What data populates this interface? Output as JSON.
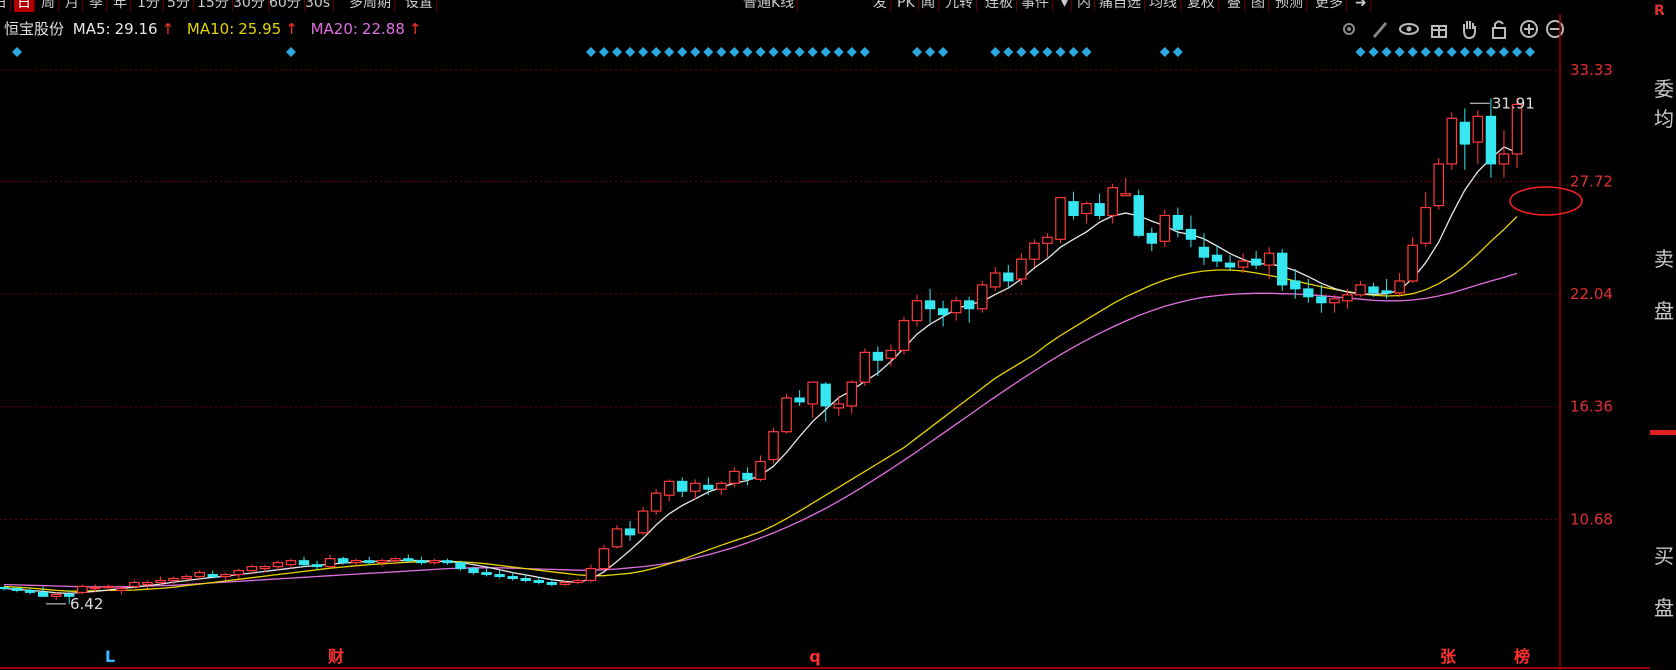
{
  "toolbar": {
    "items": [
      "日",
      "日",
      "周",
      "月",
      "季",
      "年",
      "1分",
      "5分",
      "15分",
      "30分",
      "60分",
      "30s",
      "多周期",
      "设置",
      "普通K线",
      "发",
      "PK",
      "闻",
      "九转",
      "连板",
      "事件",
      "▾",
      "内",
      "痛自选",
      "均线",
      "复权",
      "叠",
      "图",
      "预测",
      "更多",
      "➜"
    ],
    "active": "日"
  },
  "legend": {
    "stock_name": "恒宝股份",
    "ma5_label": "MA5:",
    "ma5_value": "29.16",
    "ma10_label": "MA10:",
    "ma10_value": "25.95",
    "ma20_label": "MA20:",
    "ma20_value": "22.88",
    "arrow": "↑"
  },
  "tools": [
    "settings-icon",
    "draw-icon",
    "eye-icon",
    "gift-icon",
    "hand-icon",
    "lock-icon",
    "zoom-in-icon",
    "zoom-out-icon"
  ],
  "colors": {
    "up": "#ff3b3b",
    "down": "#36e6f0",
    "ma5": "#e8e8e8",
    "ma10": "#e6d400",
    "ma20": "#e070e0",
    "grid": "#7a0000",
    "axis_text": "#e03030",
    "diamond": "#2aa8e0",
    "marker_blue": "#3ab8ff",
    "marker_red": "#ff3030"
  },
  "side_labels": [
    "R",
    "委",
    "均",
    "卖",
    "盘",
    "买",
    "盘"
  ],
  "chart_data": {
    "type": "candlestick",
    "ylim": [
      4.6,
      35.2
    ],
    "yticks": [
      10.68,
      16.36,
      22.04,
      27.72,
      33.33
    ],
    "y_tick_labels": [
      "10.68",
      "16.36",
      "22.04",
      "27.72",
      "33.33"
    ],
    "high_label": "31.91",
    "low_label": "6.42",
    "candles": [
      [
        7.25,
        7.3,
        7.1,
        7.2
      ],
      [
        7.2,
        7.25,
        7.0,
        7.1
      ],
      [
        7.1,
        7.2,
        6.9,
        7.0
      ],
      [
        7.0,
        7.3,
        6.9,
        6.8
      ],
      [
        6.8,
        7.0,
        6.6,
        6.9
      ],
      [
        6.9,
        7.1,
        6.42,
        6.8
      ],
      [
        7.0,
        7.4,
        6.9,
        7.3
      ],
      [
        7.2,
        7.4,
        7.0,
        7.25
      ],
      [
        7.25,
        7.4,
        7.1,
        7.3
      ],
      [
        7.1,
        7.3,
        6.9,
        7.2
      ],
      [
        7.3,
        7.6,
        7.2,
        7.5
      ],
      [
        7.4,
        7.6,
        7.2,
        7.5
      ],
      [
        7.5,
        7.8,
        7.4,
        7.6
      ],
      [
        7.6,
        7.8,
        7.4,
        7.7
      ],
      [
        7.7,
        7.9,
        7.5,
        7.8
      ],
      [
        7.8,
        8.1,
        7.6,
        8.0
      ],
      [
        7.9,
        8.1,
        7.7,
        7.8
      ],
      [
        7.8,
        8.0,
        7.6,
        7.9
      ],
      [
        7.9,
        8.2,
        7.7,
        8.1
      ],
      [
        8.1,
        8.4,
        7.9,
        8.3
      ],
      [
        8.2,
        8.4,
        8.0,
        8.3
      ],
      [
        8.3,
        8.6,
        8.1,
        8.5
      ],
      [
        8.4,
        8.7,
        8.2,
        8.6
      ],
      [
        8.6,
        8.8,
        8.3,
        8.4
      ],
      [
        8.4,
        8.6,
        8.1,
        8.3
      ],
      [
        8.3,
        8.9,
        8.2,
        8.7
      ],
      [
        8.7,
        8.8,
        8.4,
        8.5
      ],
      [
        8.5,
        8.7,
        8.3,
        8.6
      ],
      [
        8.6,
        8.8,
        8.4,
        8.5
      ],
      [
        8.5,
        8.7,
        8.3,
        8.6
      ],
      [
        8.6,
        8.8,
        8.4,
        8.7
      ],
      [
        8.7,
        8.9,
        8.5,
        8.6
      ],
      [
        8.6,
        8.8,
        8.4,
        8.5
      ],
      [
        8.5,
        8.7,
        8.4,
        8.6
      ],
      [
        8.6,
        8.7,
        8.4,
        8.5
      ],
      [
        8.5,
        8.6,
        8.1,
        8.2
      ],
      [
        8.2,
        8.3,
        7.9,
        8.0
      ],
      [
        8.0,
        8.2,
        7.8,
        7.9
      ],
      [
        7.9,
        8.1,
        7.7,
        7.8
      ],
      [
        7.8,
        8.0,
        7.6,
        7.7
      ],
      [
        7.7,
        7.9,
        7.5,
        7.6
      ],
      [
        7.6,
        7.8,
        7.4,
        7.5
      ],
      [
        7.5,
        7.7,
        7.3,
        7.4
      ],
      [
        7.4,
        7.6,
        7.3,
        7.5
      ],
      [
        7.5,
        7.7,
        7.4,
        7.6
      ],
      [
        7.6,
        8.4,
        7.5,
        8.2
      ],
      [
        8.2,
        9.4,
        8.1,
        9.2
      ],
      [
        9.3,
        10.4,
        9.2,
        10.2
      ],
      [
        10.2,
        10.6,
        9.6,
        9.9
      ],
      [
        10.0,
        11.3,
        9.9,
        11.1
      ],
      [
        11.1,
        12.2,
        10.9,
        12.0
      ],
      [
        11.9,
        12.7,
        11.6,
        12.6
      ],
      [
        12.6,
        12.8,
        11.8,
        12.1
      ],
      [
        12.1,
        12.7,
        11.7,
        12.5
      ],
      [
        12.4,
        12.8,
        11.9,
        12.2
      ],
      [
        12.2,
        12.6,
        11.9,
        12.5
      ],
      [
        12.5,
        13.3,
        12.3,
        13.1
      ],
      [
        13.0,
        13.3,
        12.4,
        12.7
      ],
      [
        12.7,
        13.9,
        12.6,
        13.6
      ],
      [
        13.7,
        15.3,
        13.5,
        15.1
      ],
      [
        15.1,
        17.0,
        15.0,
        16.8
      ],
      [
        16.8,
        17.2,
        16.4,
        16.6
      ],
      [
        16.5,
        17.6,
        15.8,
        17.6
      ],
      [
        17.5,
        17.6,
        15.6,
        16.4
      ],
      [
        16.3,
        16.9,
        15.9,
        16.5
      ],
      [
        16.4,
        17.7,
        16.0,
        17.6
      ],
      [
        17.6,
        19.3,
        17.4,
        19.1
      ],
      [
        19.1,
        19.4,
        17.9,
        18.7
      ],
      [
        18.8,
        19.5,
        18.4,
        19.2
      ],
      [
        19.2,
        20.9,
        19.0,
        20.7
      ],
      [
        20.7,
        22.0,
        20.4,
        21.7
      ],
      [
        21.7,
        22.3,
        20.6,
        21.3
      ],
      [
        21.3,
        21.7,
        20.4,
        21.0
      ],
      [
        21.1,
        21.9,
        20.7,
        21.7
      ],
      [
        21.7,
        21.9,
        20.6,
        21.3
      ],
      [
        21.3,
        22.7,
        21.1,
        22.5
      ],
      [
        22.4,
        23.4,
        22.2,
        23.1
      ],
      [
        23.1,
        23.5,
        22.3,
        22.7
      ],
      [
        22.8,
        24.1,
        22.5,
        23.8
      ],
      [
        23.8,
        24.8,
        23.4,
        24.6
      ],
      [
        24.6,
        25.1,
        23.9,
        24.9
      ],
      [
        24.8,
        26.9,
        24.6,
        26.9
      ],
      [
        26.7,
        27.2,
        25.8,
        26.0
      ],
      [
        26.1,
        26.7,
        25.6,
        26.6
      ],
      [
        26.6,
        27.1,
        25.8,
        26.0
      ],
      [
        26.0,
        27.6,
        25.6,
        27.4
      ],
      [
        27.0,
        27.9,
        27.0,
        27.1
      ],
      [
        27.0,
        27.3,
        24.9,
        25.0
      ],
      [
        25.1,
        25.4,
        24.2,
        24.6
      ],
      [
        24.7,
        26.3,
        24.4,
        26.0
      ],
      [
        26.0,
        26.4,
        24.9,
        25.3
      ],
      [
        25.3,
        26.0,
        24.4,
        24.8
      ],
      [
        24.4,
        25.1,
        23.5,
        23.9
      ],
      [
        24.0,
        24.5,
        23.4,
        23.7
      ],
      [
        23.6,
        24.0,
        23.2,
        23.4
      ],
      [
        23.4,
        24.1,
        23.1,
        23.7
      ],
      [
        23.8,
        24.2,
        23.3,
        23.5
      ],
      [
        23.5,
        24.4,
        22.8,
        24.1
      ],
      [
        24.1,
        24.3,
        22.2,
        22.5
      ],
      [
        22.7,
        23.3,
        21.8,
        22.3
      ],
      [
        22.3,
        22.8,
        21.6,
        21.9
      ],
      [
        21.9,
        22.5,
        21.1,
        21.6
      ],
      [
        21.6,
        22.0,
        21.1,
        21.8
      ],
      [
        21.7,
        22.3,
        21.3,
        22.0
      ],
      [
        22.0,
        22.7,
        21.9,
        22.5
      ],
      [
        22.4,
        22.6,
        21.9,
        22.1
      ],
      [
        22.2,
        22.8,
        21.8,
        22.1
      ],
      [
        22.1,
        23.1,
        21.9,
        22.7
      ],
      [
        22.7,
        24.9,
        22.6,
        24.5
      ],
      [
        24.6,
        27.2,
        24.4,
        26.4
      ],
      [
        26.5,
        28.9,
        26.3,
        28.6
      ],
      [
        28.6,
        31.2,
        28.3,
        30.9
      ],
      [
        30.7,
        31.4,
        28.3,
        29.6
      ],
      [
        29.7,
        31.3,
        28.6,
        31.0
      ],
      [
        31.0,
        31.9,
        27.9,
        28.6
      ],
      [
        28.6,
        30.3,
        27.9,
        29.1
      ],
      [
        29.1,
        31.9,
        28.4,
        31.6
      ]
    ],
    "ma5": [
      7.2,
      7.15,
      7.1,
      7.05,
      6.98,
      6.95,
      7.0,
      7.05,
      7.12,
      7.2,
      7.26,
      7.34,
      7.42,
      7.52,
      7.6,
      7.68,
      7.76,
      7.82,
      7.9,
      7.98,
      8.06,
      8.14,
      8.22,
      8.3,
      8.36,
      8.42,
      8.48,
      8.52,
      8.56,
      8.58,
      8.6,
      8.62,
      8.6,
      8.58,
      8.55,
      8.5,
      8.4,
      8.28,
      8.14,
      8.0,
      7.88,
      7.76,
      7.64,
      7.56,
      7.5,
      7.68,
      8.04,
      8.56,
      9.12,
      9.72,
      10.4,
      10.96,
      11.38,
      11.72,
      12.06,
      12.3,
      12.5,
      12.64,
      12.9,
      13.36,
      14.06,
      14.86,
      15.62,
      16.22,
      16.82,
      17.18,
      17.64,
      18.06,
      18.64,
      19.32,
      20.02,
      20.52,
      20.9,
      21.28,
      21.52,
      21.66,
      22.02,
      22.34,
      22.8,
      23.36,
      23.82,
      24.4,
      24.8,
      25.18,
      25.66,
      25.98,
      26.12,
      25.98,
      25.72,
      25.48,
      25.16,
      25.04,
      24.82,
      24.46,
      24.08,
      23.78,
      23.56,
      23.56,
      23.44,
      23.22,
      22.92,
      22.58,
      22.32,
      22.14,
      22.04,
      22.02,
      22.06,
      22.24,
      22.82,
      23.62,
      24.66,
      26.04,
      27.28,
      28.22,
      28.88,
      29.46,
      29.16
    ],
    "ma10": [
      7.3,
      7.26,
      7.22,
      7.16,
      7.1,
      7.06,
      7.06,
      7.08,
      7.1,
      7.1,
      7.12,
      7.16,
      7.2,
      7.26,
      7.34,
      7.42,
      7.5,
      7.58,
      7.66,
      7.74,
      7.82,
      7.9,
      7.98,
      8.06,
      8.14,
      8.22,
      8.28,
      8.34,
      8.4,
      8.44,
      8.48,
      8.52,
      8.54,
      8.56,
      8.56,
      8.54,
      8.5,
      8.44,
      8.36,
      8.28,
      8.2,
      8.12,
      8.04,
      7.96,
      7.88,
      7.84,
      7.84,
      7.9,
      7.96,
      8.08,
      8.24,
      8.44,
      8.66,
      8.9,
      9.14,
      9.38,
      9.6,
      9.82,
      10.06,
      10.36,
      10.72,
      11.1,
      11.5,
      11.9,
      12.3,
      12.7,
      13.1,
      13.5,
      13.9,
      14.3,
      14.8,
      15.3,
      15.8,
      16.3,
      16.8,
      17.3,
      17.8,
      18.2,
      18.6,
      19.0,
      19.5,
      19.95,
      20.35,
      20.75,
      21.15,
      21.55,
      21.9,
      22.2,
      22.5,
      22.75,
      22.95,
      23.1,
      23.2,
      23.25,
      23.25,
      23.2,
      23.1,
      22.98,
      22.85,
      22.7,
      22.55,
      22.4,
      22.28,
      22.16,
      22.06,
      21.98,
      21.94,
      21.96,
      22.06,
      22.26,
      22.56,
      22.96,
      23.46,
      24.06,
      24.7,
      25.3,
      25.95
    ],
    "ma20": [
      7.4,
      7.38,
      7.36,
      7.34,
      7.32,
      7.3,
      7.28,
      7.28,
      7.28,
      7.28,
      7.3,
      7.32,
      7.34,
      7.36,
      7.4,
      7.44,
      7.48,
      7.52,
      7.56,
      7.6,
      7.64,
      7.68,
      7.72,
      7.76,
      7.8,
      7.84,
      7.88,
      7.92,
      7.96,
      8.0,
      8.04,
      8.08,
      8.12,
      8.16,
      8.2,
      8.22,
      8.24,
      8.24,
      8.24,
      8.22,
      8.2,
      8.18,
      8.16,
      8.14,
      8.12,
      8.12,
      8.14,
      8.18,
      8.24,
      8.3,
      8.38,
      8.48,
      8.6,
      8.74,
      8.9,
      9.08,
      9.28,
      9.5,
      9.74,
      10.0,
      10.28,
      10.58,
      10.9,
      11.24,
      11.6,
      11.98,
      12.38,
      12.8,
      13.22,
      13.66,
      14.1,
      14.56,
      15.02,
      15.48,
      15.94,
      16.4,
      16.86,
      17.3,
      17.74,
      18.16,
      18.58,
      18.98,
      19.36,
      19.72,
      20.06,
      20.38,
      20.68,
      20.96,
      21.2,
      21.42,
      21.6,
      21.76,
      21.88,
      21.96,
      22.02,
      22.06,
      22.08,
      22.08,
      22.06,
      22.04,
      22.0,
      21.96,
      21.9,
      21.84,
      21.78,
      21.72,
      21.7,
      21.7,
      21.74,
      21.82,
      21.94,
      22.1,
      22.3,
      22.5,
      22.7,
      22.88,
      23.08
    ]
  },
  "markers": {
    "bottom": [
      {
        "text": "L",
        "color": "#3ab8ff"
      },
      {
        "text": "财",
        "color": "#ff3030"
      },
      {
        "text": "q",
        "color": "#ff3030"
      },
      {
        "text": "张",
        "color": "#ff3030"
      },
      {
        "text": "榜",
        "color": "#ff3030"
      }
    ]
  }
}
